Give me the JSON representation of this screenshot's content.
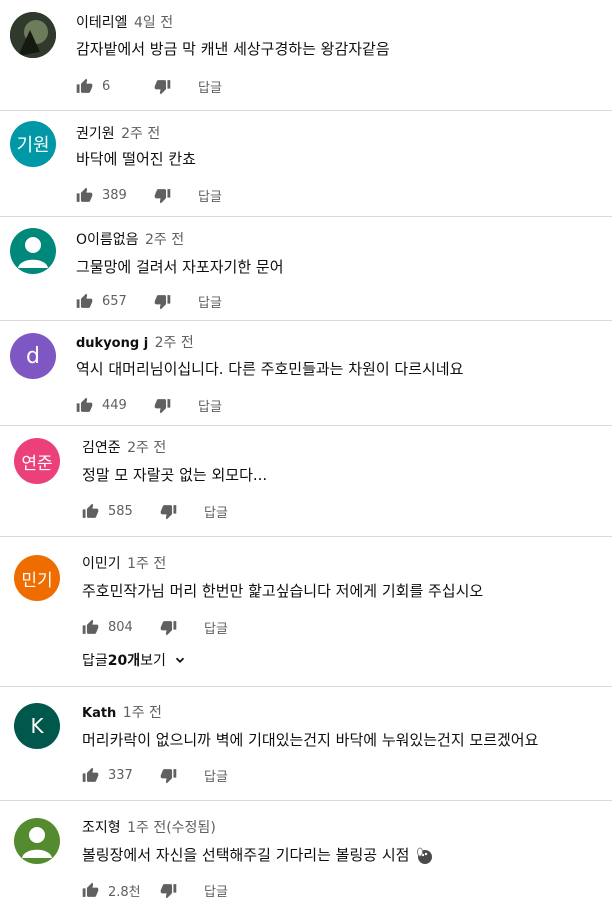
{
  "reply_label": "답글",
  "comments": [
    {
      "author": "이테리엘",
      "time": "4일 전",
      "text": "감자밭에서 방금 막 캐낸 세상구경하는 왕감자같음",
      "likes": "6",
      "avatar_letter": "",
      "avatar_color": "#3a3a3a"
    },
    {
      "author": "권기원",
      "time": "2주 전",
      "text": "바닥에 떨어진 칸쵸",
      "likes": "389",
      "avatar_letter": "기원",
      "avatar_color": "#0097a7"
    },
    {
      "author": "O이름없음",
      "time": "2주 전",
      "text": "그물망에 걸려서 자포자기한 문어",
      "likes": "657",
      "avatar_letter": "",
      "avatar_color": "#00897b"
    },
    {
      "author": "dukyong j",
      "time": "2주 전",
      "text": "역시 대머리님이십니다. 다른 주호민들과는 차원이 다르시네요",
      "likes": "449",
      "avatar_letter": "d",
      "avatar_color": "#7e57c2"
    },
    {
      "author": "김연준",
      "time": "2주 전",
      "text": "정말 모 자랄곳 없는 외모다...",
      "likes": "585",
      "avatar_letter": "연준",
      "avatar_color": "#ec407a"
    },
    {
      "author": "이민기",
      "time": "1주 전",
      "text": "주호민작가님 머리 한번만 핥고싶습니다 저에게 기회를 주십시오",
      "likes": "804",
      "avatar_letter": "민기",
      "avatar_color": "#ef6c00"
    },
    {
      "author": "Kath",
      "time": "1주 전",
      "text": "머리카락이 없으니까 벽에 기대있는건지 바닥에 누워있는건지 모르겠어요",
      "likes": "337",
      "avatar_letter": "K",
      "avatar_color": "#00574b"
    },
    {
      "author": "조지형",
      "time": "1주 전(수정됨)",
      "text": "볼링장에서 자신을 선택해주길 기다리는 볼링공 시점",
      "likes": "2.8천",
      "avatar_letter": "",
      "avatar_color": "#558b2f"
    }
  ],
  "view_replies": {
    "prefix": "답글 ",
    "count": "20개",
    "suffix": " 보기"
  }
}
